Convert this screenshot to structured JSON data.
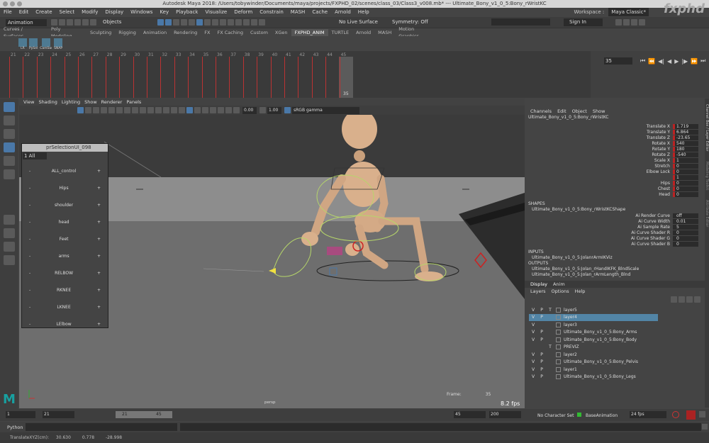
{
  "titlebar": {
    "title": "Autodesk Maya 2018: /Users/tobywinder/Documents/maya/projects/FXPHD_02/scenes/class_03/Class3_v008.mb*  ---  Ultimate_Bony_v1_0_5:Bony_rWristKC"
  },
  "menubar": {
    "items": [
      "File",
      "Edit",
      "Create",
      "Select",
      "Modify",
      "Display",
      "Windows",
      "Key",
      "Playback",
      "Visualize",
      "Deform",
      "Constrain",
      "MASH",
      "Cache",
      "Arnold",
      "Help"
    ],
    "workspace_label": "Workspace :",
    "workspace_value": "Maya Classic*"
  },
  "watermark": "fxphd",
  "status": {
    "mode": "Animation",
    "objects": "Objects",
    "live_surface": "No Live Surface",
    "symmetry": "Symmetry: Off",
    "sign_in": "Sign In"
  },
  "shelf": {
    "tabs": [
      "Curves / Surfaces",
      "Poly Modeling",
      "Sculpting",
      "Rigging",
      "Animation",
      "Rendering",
      "FX",
      "FX Caching",
      "Custom",
      "XGen",
      "FXPHD_ANIM",
      "TURTLE",
      "Arnold",
      "MASH",
      "Motion Graphics"
    ],
    "active_tab": "FXPHD_ANIM",
    "buttons": [
      "LR",
      "PySel",
      "CamSw",
      "SNAP"
    ]
  },
  "timeline": {
    "ticks": [
      "21",
      "22",
      "23",
      "24",
      "25",
      "26",
      "27",
      "28",
      "29",
      "30",
      "31",
      "32",
      "33",
      "34",
      "35",
      "36",
      "37",
      "38",
      "39",
      "40",
      "41",
      "42",
      "43",
      "44",
      "45"
    ],
    "current_frame_marker": "35",
    "current_frame_field": "35"
  },
  "viewport": {
    "menu": [
      "View",
      "Shading",
      "Lighting",
      "Show",
      "Renderer",
      "Panels"
    ],
    "exposure": "0.00",
    "gamma": "1.00",
    "color_space": "sRGB gamma",
    "camera": "persp",
    "frame_label": "Frame:",
    "frame_value": "35",
    "fps": "8.2 fps"
  },
  "selection_panel": {
    "title": "prSelectionUI_098",
    "dropdown": "1 All",
    "items": [
      "ALL_control",
      "Hips",
      "shoulder",
      "head",
      "Feet",
      "arms",
      "RELBOW",
      "RKNEE",
      "LKNEE",
      "LElbow"
    ]
  },
  "channelbox": {
    "menu": [
      "Channels",
      "Edit",
      "Object",
      "Show"
    ],
    "object": "Ultimate_Bony_v1_0_5:Bony_rWristKC",
    "attrs": [
      {
        "name": "Translate X",
        "value": "1.719"
      },
      {
        "name": "Translate Y",
        "value": "6.864"
      },
      {
        "name": "Translate Z",
        "value": "-23.65"
      },
      {
        "name": "Rotate X",
        "value": "540"
      },
      {
        "name": "Rotate Y",
        "value": "180"
      },
      {
        "name": "Rotate Z",
        "value": "-540"
      },
      {
        "name": "Scale X",
        "value": "1"
      },
      {
        "name": "Stretch",
        "value": "0"
      },
      {
        "name": "Elbow Lock",
        "value": "0"
      },
      {
        "name": "",
        "value": "1"
      },
      {
        "name": "Hips",
        "value": "0"
      },
      {
        "name": "Chest",
        "value": "0"
      },
      {
        "name": "Head",
        "value": "0"
      }
    ],
    "shapes_label": "SHAPES",
    "shape_name": "Ultimate_Bony_v1_0_5:Bony_rWristKCShape",
    "shape_attrs": [
      {
        "name": "Ai Render Curve",
        "value": "off"
      },
      {
        "name": "Ai Curve Width",
        "value": "0.01"
      },
      {
        "name": "Ai Sample Rate",
        "value": "5"
      },
      {
        "name": "Ai Curve Shader R",
        "value": "0"
      },
      {
        "name": "Ai Curve Shader G",
        "value": "0"
      },
      {
        "name": "Ai Curve Shader B",
        "value": "0"
      }
    ],
    "inputs_label": "INPUTS",
    "inputs": [
      "Ultimate_Bony_v1_0_5:JolanrArmIKViz"
    ],
    "outputs_label": "OUTPUTS",
    "outputs": [
      "Ultimate_Bony_v1_0_5:Jolan_rHandIKFK_BlndScale",
      "Ultimate_Bony_v1_0_5:Jolan_rArmLength_Blnd"
    ]
  },
  "side_tabs": [
    "Channel Box / Layer Editor",
    "Modeling Toolkit",
    "Attribute Editor"
  ],
  "layers": {
    "tabs": [
      "Display",
      "Anim"
    ],
    "menu": [
      "Layers",
      "Options",
      "Help"
    ],
    "rows": [
      {
        "v": "V",
        "p": "P",
        "t": "T",
        "name": "layer5"
      },
      {
        "v": "V",
        "p": "P",
        "t": "",
        "name": "layer4",
        "selected": true
      },
      {
        "v": "V",
        "p": "",
        "t": "",
        "name": "layer3"
      },
      {
        "v": "V",
        "p": "P",
        "t": "",
        "name": "Ultimate_Bony_v1_0_5:Bony_Arms"
      },
      {
        "v": "V",
        "p": "P",
        "t": "",
        "name": "Ultimate_Bony_v1_0_5:Bony_Body"
      },
      {
        "v": "",
        "p": "",
        "t": "T",
        "name": "PREVIZ"
      },
      {
        "v": "V",
        "p": "P",
        "t": "",
        "name": "layer2"
      },
      {
        "v": "V",
        "p": "P",
        "t": "",
        "name": "Ultimate_Bony_v1_0_5:Bony_Pelvis"
      },
      {
        "v": "V",
        "p": "P",
        "t": "",
        "name": "layer1"
      },
      {
        "v": "V",
        "p": "P",
        "t": "",
        "name": "Ultimate_Bony_v1_0_5:Bony_Legs"
      }
    ]
  },
  "range": {
    "start": "1",
    "inner_start": "21",
    "slider_start": "21",
    "slider_end": "45",
    "inner_end": "45",
    "end": "200",
    "character": "No Character Set",
    "anim_layer": "BaseAnimation",
    "fps": "24 fps"
  },
  "cmd": {
    "lang": "Python"
  },
  "help": {
    "text": "TranslateXYZ(cm):",
    "x": "30.630",
    "y": "0.778",
    "z": "-28.998"
  },
  "colors": {
    "accent": "#5285a6",
    "key_red": "#b22222"
  }
}
